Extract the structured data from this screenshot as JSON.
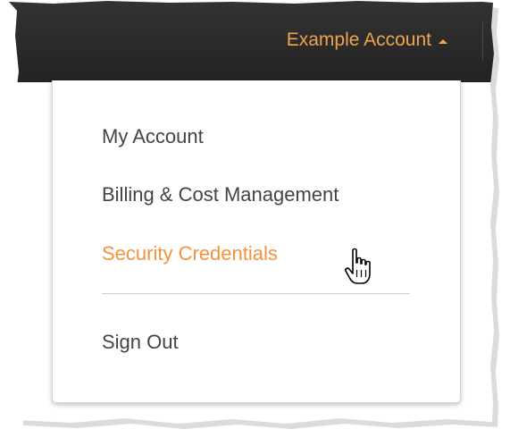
{
  "header": {
    "account_label": "Example Account",
    "account_caret_icon": "caret-up-icon"
  },
  "menu": {
    "items": [
      {
        "label": "My Account",
        "active": false
      },
      {
        "label": "Billing & Cost Management",
        "active": false
      },
      {
        "label": "Security Credentials",
        "active": true
      },
      {
        "label": "Sign Out",
        "active": false
      }
    ]
  },
  "cursor": {
    "icon": "hand-pointer-icon"
  },
  "colors": {
    "accent": "#f3933b",
    "topbar": "#2a2a2a",
    "menu_text": "#444444"
  }
}
